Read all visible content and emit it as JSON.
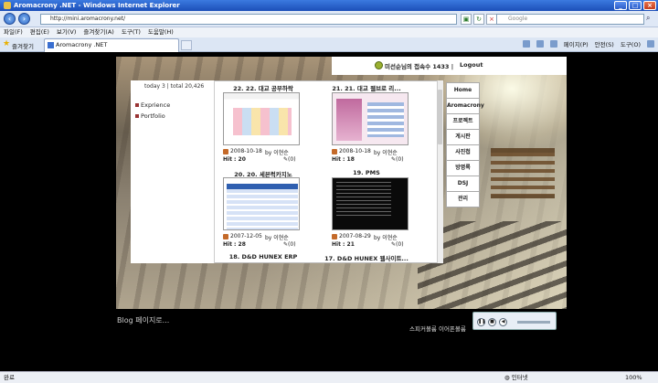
{
  "window": {
    "title": "Aromacrony .NET - Windows Internet Explorer"
  },
  "address": {
    "url": "http://mini.aromacrony.net/"
  },
  "search": {
    "placeholder": "Google"
  },
  "menu": [
    "파일(F)",
    "편집(E)",
    "보기(V)",
    "즐겨찾기(A)",
    "도구(T)",
    "도움말(H)"
  ],
  "favorites": {
    "label": "즐겨찾기"
  },
  "tab": {
    "label": "Aromacrony .NET"
  },
  "right_tools": {
    "page": "페이지(P)",
    "safety": "안전(S)",
    "tools": "도구(O)"
  },
  "header": {
    "visitor": "미선순님의 접속수 1433 |",
    "logout": "Logout"
  },
  "counter": {
    "text": "today 3 | total 20,426"
  },
  "left_nav": [
    {
      "label": "Exprience"
    },
    {
      "label": "Portfolio"
    }
  ],
  "items": [
    {
      "title": "22. 22. 대교 공부하락",
      "date": "2008-10-18",
      "author": "by 이현순",
      "hit": "Hit : 20",
      "comments": "(0)"
    },
    {
      "title": "21. 21. 대교 웹브로 리...",
      "date": "2008-10-18",
      "author": "by 이현순",
      "hit": "Hit : 18",
      "comments": "(0)"
    },
    {
      "title": "20. 20. 세븐럭카지노",
      "date": "2007-12-05",
      "author": "by 이현순",
      "hit": "Hit : 28",
      "comments": "(0)"
    },
    {
      "title": "19. PMS",
      "date": "2007-08-29",
      "author": "by 이현순",
      "hit": "Hit : 21",
      "comments": "(0)"
    },
    {
      "title": "18. D&D HUNEX ERP"
    },
    {
      "title": "17. D&D HUNEX 웹사이트..."
    }
  ],
  "side_menu": [
    "Home",
    "Aromacrony",
    "프로젝트",
    "게시판",
    "사진첩",
    "방명록",
    "DSJ",
    "관리"
  ],
  "footer": {
    "blog": "Blog 페이지로...",
    "speaker": "스피커볼륨 이어폰볼륨"
  },
  "status": {
    "text": "완료",
    "zone": "인터넷",
    "zoom": "100%"
  }
}
